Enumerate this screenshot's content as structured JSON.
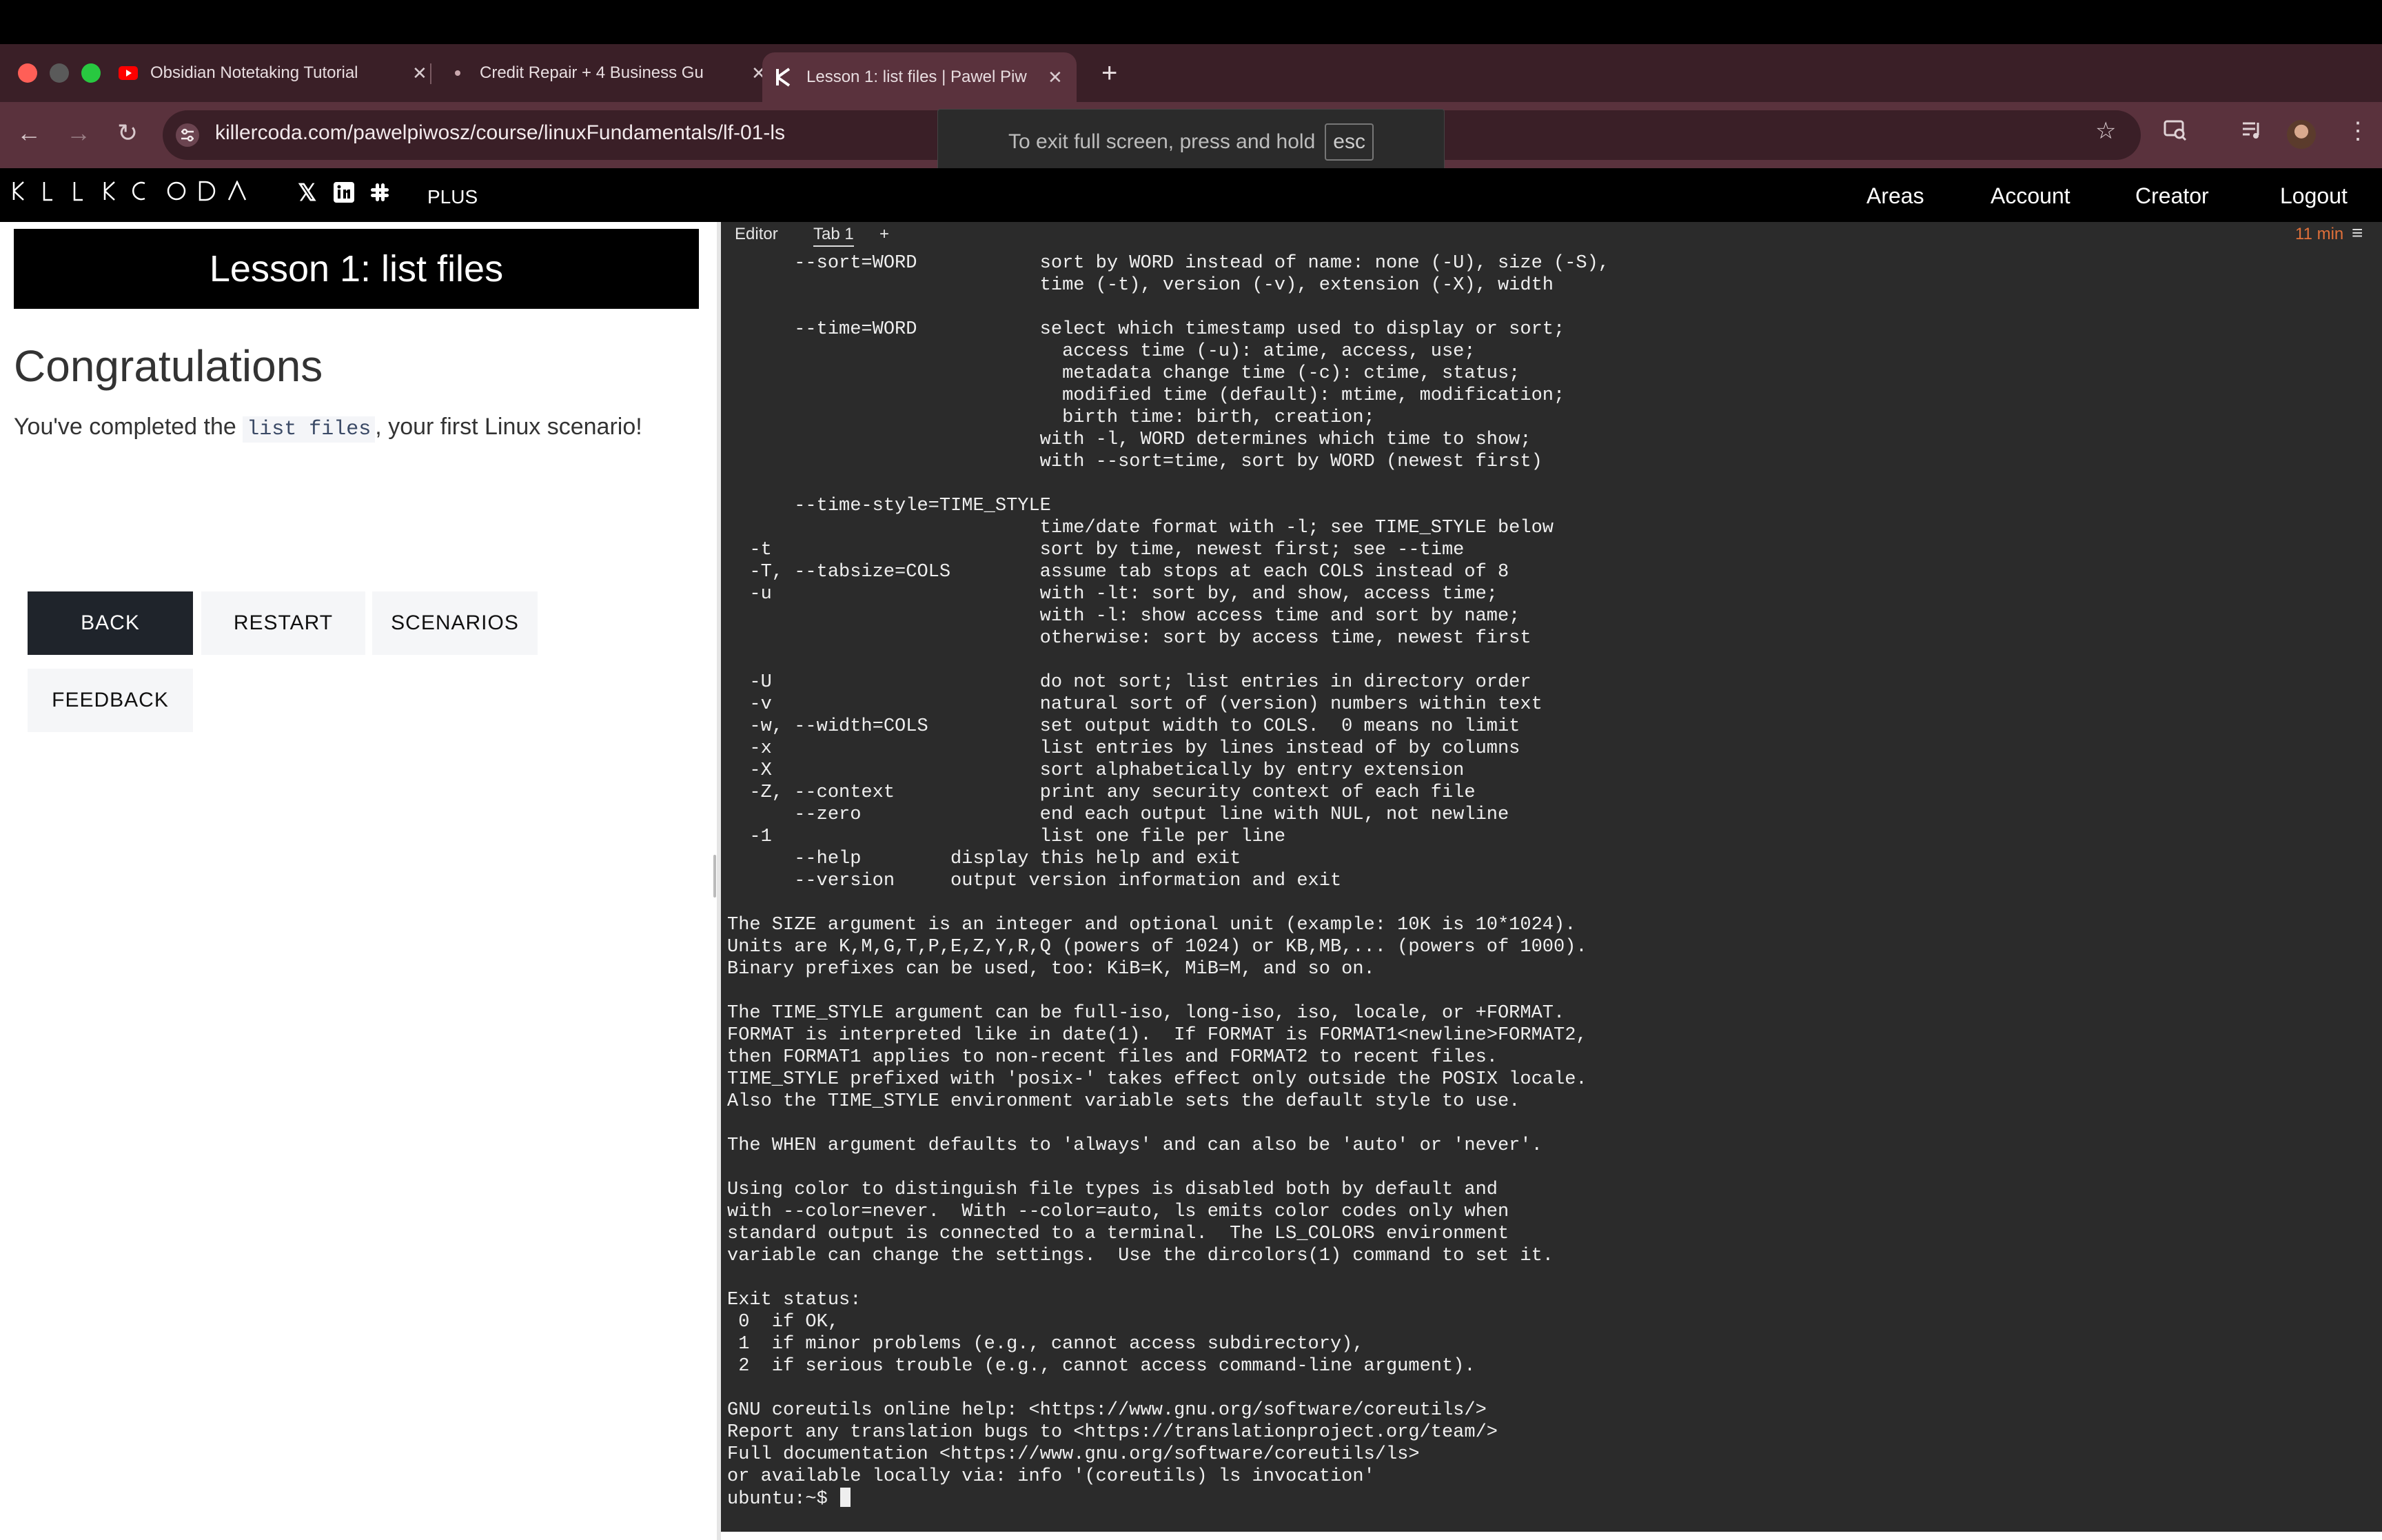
{
  "browser": {
    "tabs": [
      {
        "label": "Obsidian Notetaking Tutorial",
        "favicon": "youtube-icon"
      },
      {
        "label": "Credit Repair + 4 Business Gu",
        "favicon": "page-icon"
      },
      {
        "label": "Lesson 1: list files | Pawel Piw",
        "favicon": "killercoda-k-icon",
        "active": true
      }
    ],
    "url": "killercoda.com/pawelpiwosz/course/linuxFundamentals/lf-01-ls",
    "fullscreen_toast": {
      "text": "To exit full screen, press and hold",
      "key": "esc"
    },
    "colors": {
      "tab_strip": "#3a1f27",
      "toolbar": "#5a323d"
    }
  },
  "site": {
    "logo": "KILLERCODA",
    "plus_label": "PLUS",
    "nav": [
      "Areas",
      "Account",
      "Creator",
      "Logout"
    ]
  },
  "lesson": {
    "title": "Lesson 1: list files",
    "heading": "Congratulations",
    "message_before": "You've completed the",
    "message_code": "list files",
    "message_after": ", your first Linux scenario!",
    "buttons": {
      "back": "BACK",
      "restart": "RESTART",
      "scenarios": "SCENARIOS",
      "feedback": "FEEDBACK"
    }
  },
  "terminal": {
    "tabs": {
      "editor": "Editor",
      "tab1": "Tab 1",
      "add": "+"
    },
    "timer": "11 min",
    "output": "      --sort=WORD           sort by WORD instead of name: none (-U), size (-S),\n                            time (-t), version (-v), extension (-X), width\n\n      --time=WORD           select which timestamp used to display or sort;\n                              access time (-u): atime, access, use;\n                              metadata change time (-c): ctime, status;\n                              modified time (default): mtime, modification;\n                              birth time: birth, creation;\n                            with -l, WORD determines which time to show;\n                            with --sort=time, sort by WORD (newest first)\n\n      --time-style=TIME_STYLE\n                            time/date format with -l; see TIME_STYLE below\n  -t                        sort by time, newest first; see --time\n  -T, --tabsize=COLS        assume tab stops at each COLS instead of 8\n  -u                        with -lt: sort by, and show, access time;\n                            with -l: show access time and sort by name;\n                            otherwise: sort by access time, newest first\n\n  -U                        do not sort; list entries in directory order\n  -v                        natural sort of (version) numbers within text\n  -w, --width=COLS          set output width to COLS.  0 means no limit\n  -x                        list entries by lines instead of by columns\n  -X                        sort alphabetically by entry extension\n  -Z, --context             print any security context of each file\n      --zero                end each output line with NUL, not newline\n  -1                        list one file per line\n      --help        display this help and exit\n      --version     output version information and exit\n\nThe SIZE argument is an integer and optional unit (example: 10K is 10*1024).\nUnits are K,M,G,T,P,E,Z,Y,R,Q (powers of 1024) or KB,MB,... (powers of 1000).\nBinary prefixes can be used, too: KiB=K, MiB=M, and so on.\n\nThe TIME_STYLE argument can be full-iso, long-iso, iso, locale, or +FORMAT.\nFORMAT is interpreted like in date(1).  If FORMAT is FORMAT1<newline>FORMAT2,\nthen FORMAT1 applies to non-recent files and FORMAT2 to recent files.\nTIME_STYLE prefixed with 'posix-' takes effect only outside the POSIX locale.\nAlso the TIME_STYLE environment variable sets the default style to use.\n\nThe WHEN argument defaults to 'always' and can also be 'auto' or 'never'.\n\nUsing color to distinguish file types is disabled both by default and\nwith --color=never.  With --color=auto, ls emits color codes only when\nstandard output is connected to a terminal.  The LS_COLORS environment\nvariable can change the settings.  Use the dircolors(1) command to set it.\n\nExit status:\n 0  if OK,\n 1  if minor problems (e.g., cannot access subdirectory),\n 2  if serious trouble (e.g., cannot access command-line argument).\n\nGNU coreutils online help: <https://www.gnu.org/software/coreutils/>\nReport any translation bugs to <https://translationproject.org/team/>\nFull documentation <https://www.gnu.org/software/coreutils/ls>\nor available locally via: info '(coreutils) ls invocation'\n",
    "prompt": "ubuntu:~$ "
  }
}
